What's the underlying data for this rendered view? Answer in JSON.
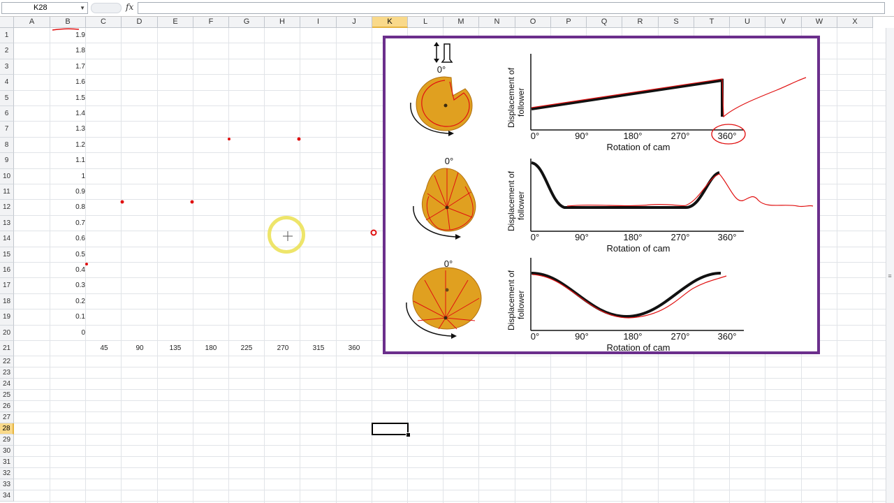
{
  "formula_bar": {
    "name_box": "K28",
    "fx_label": "fx",
    "formula": ""
  },
  "columns": [
    "A",
    "B",
    "C",
    "D",
    "E",
    "F",
    "G",
    "H",
    "I",
    "J",
    "K",
    "L",
    "M",
    "N",
    "O",
    "P",
    "Q",
    "R",
    "S",
    "T",
    "U",
    "V",
    "W",
    "X"
  ],
  "selected_column": "K",
  "rows": [
    "1",
    "2",
    "3",
    "4",
    "5",
    "6",
    "7",
    "8",
    "9",
    "10",
    "11",
    "12",
    "13",
    "14",
    "15",
    "16",
    "17",
    "18",
    "19",
    "20",
    "21",
    "22",
    "23",
    "24",
    "25",
    "26",
    "27",
    "28",
    "29",
    "30",
    "31",
    "32",
    "33",
    "34"
  ],
  "selected_row": "28",
  "sheet_chart": {
    "y_ticks": [
      "1.9",
      "1.8",
      "1.7",
      "1.6",
      "1.5",
      "1.4",
      "1.3",
      "1.2",
      "1.1",
      "1",
      "0.9",
      "0.8",
      "0.7",
      "0.6",
      "0.5",
      "0.4",
      "0.3",
      "0.2",
      "0.1",
      "0"
    ],
    "x_ticks": [
      "45",
      "90",
      "135",
      "180",
      "225",
      "270",
      "315",
      "360"
    ]
  },
  "figure": {
    "follower_degree": "0°",
    "cam_labels": [
      "0°",
      "0°"
    ],
    "y_axis_line1": "Displacement of",
    "y_axis_line2": "follower",
    "x_axis_label": "Rotation of cam",
    "x_ticks": [
      "0°",
      "90°",
      "180°",
      "270°",
      "360°"
    ]
  },
  "colors": {
    "frame": "#6b2f8c",
    "ink": "#e01010",
    "cam": "#e0a020",
    "selected_header": "#f9d98a"
  }
}
